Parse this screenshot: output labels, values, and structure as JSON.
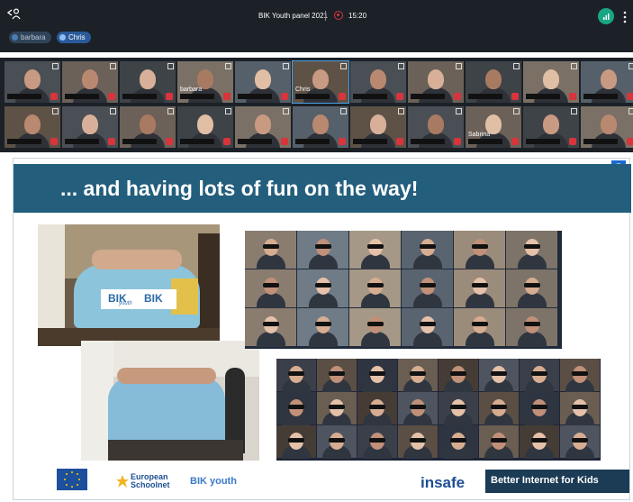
{
  "topbar": {
    "title": "BIK Youth panel 2021",
    "time": "15:20",
    "participants": [
      {
        "name": "barbara",
        "color": "#4a7db0"
      },
      {
        "name": "Chris",
        "color": "#3b82d6"
      }
    ]
  },
  "grid_labels": {
    "barbara": "barbara",
    "chris": "Chris",
    "sabrina": "Sabrina"
  },
  "slide": {
    "title": "... and having lots of fun on the way!",
    "minimize_glyph": "–",
    "banner_text": "BIK",
    "banner_sub": "youth"
  },
  "footer": {
    "european_schoolnet": "European Schoolnet",
    "bik_youth": "BIK youth",
    "insafe": "insafe",
    "better_internet": "Better Internet for Kids"
  },
  "colors": {
    "dark": "#1b2127",
    "slide_title_bg": "#235e7d",
    "accent_red": "#d8343c",
    "accent_green": "#1aa684"
  }
}
